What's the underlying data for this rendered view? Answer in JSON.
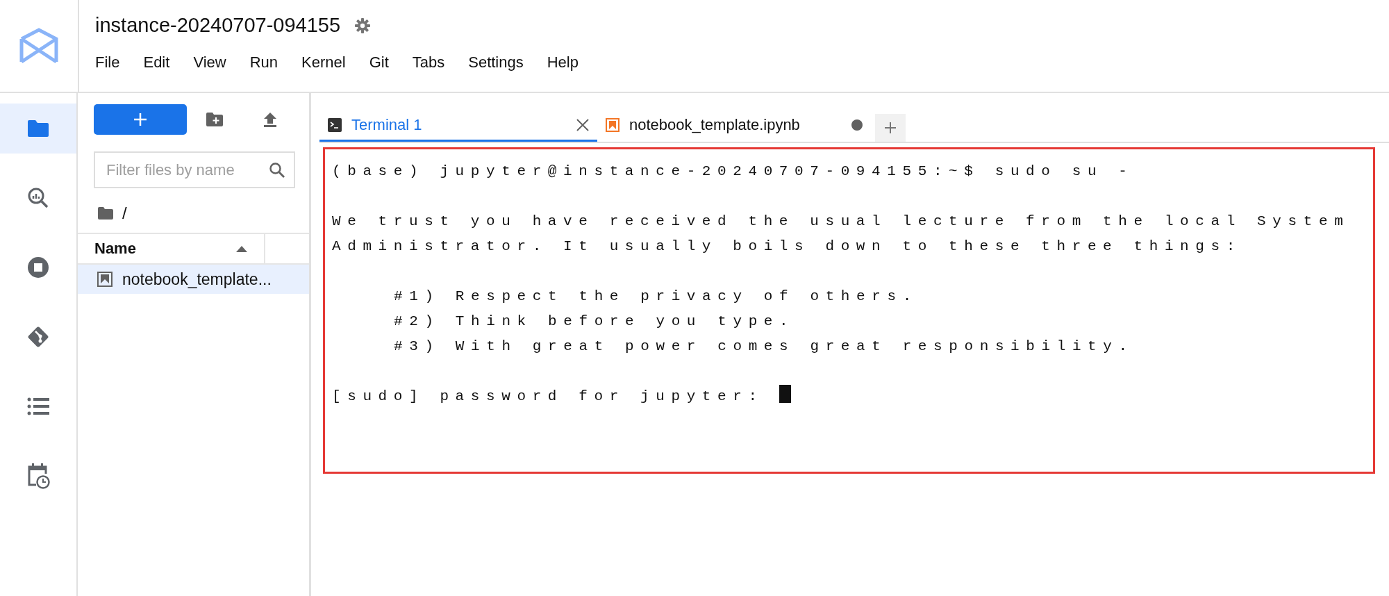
{
  "header": {
    "title": "instance-20240707-094155",
    "menu": [
      "File",
      "Edit",
      "View",
      "Run",
      "Kernel",
      "Git",
      "Tabs",
      "Settings",
      "Help"
    ]
  },
  "sidebar": {
    "items": [
      {
        "kind": "files",
        "selected": true
      },
      {
        "kind": "insights",
        "selected": false
      },
      {
        "kind": "running",
        "selected": false
      },
      {
        "kind": "git",
        "selected": false
      },
      {
        "kind": "toc",
        "selected": false
      },
      {
        "kind": "schedule",
        "selected": false
      }
    ]
  },
  "file_browser": {
    "search": {
      "placeholder": "Filter files by name"
    },
    "path": "/",
    "columns": [
      {
        "label": "Name",
        "sort_ascending": true
      }
    ],
    "rows": [
      {
        "name": "notebook_template...",
        "kind": "notebook",
        "selected": true
      }
    ]
  },
  "tabs": [
    {
      "label": "Terminal 1",
      "kind": "terminal",
      "selected": true,
      "unsaved": false
    },
    {
      "label": "notebook_template.ipynb",
      "kind": "notebook",
      "selected": false,
      "unsaved": true
    }
  ],
  "terminal": {
    "highlighted": true,
    "cursor": true,
    "paragraphs": [
      {
        "kind": "plain",
        "lines": [
          "(base) jupyter@instance-20240707-094155:~$ sudo su -"
        ]
      },
      {
        "kind": "plain",
        "lines": [
          "We trust you have received the usual lecture from the local System",
          "Administrator. It usually boils down to these three things:"
        ]
      },
      {
        "kind": "indented",
        "lines": [
          "#1) Respect the privacy of others.",
          "#2) Think before you type.",
          "#3) With great power comes great responsibility."
        ]
      },
      {
        "kind": "plain",
        "lines": [
          "[sudo] password for jupyter: "
        ]
      }
    ]
  }
}
